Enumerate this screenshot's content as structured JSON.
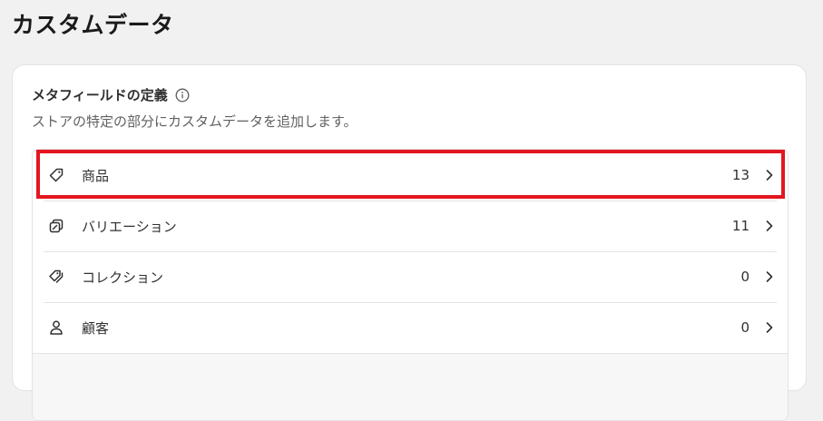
{
  "header": {
    "title": "カスタムデータ"
  },
  "metafields": {
    "title": "メタフィールドの定義",
    "subtitle": "ストアの特定の部分にカスタムデータを追加します。",
    "items": [
      {
        "label": "商品",
        "count": "13",
        "icon": "tag-icon"
      },
      {
        "label": "バリエーション",
        "count": "11",
        "icon": "variant-icon"
      },
      {
        "label": "コレクション",
        "count": "0",
        "icon": "collection-icon"
      },
      {
        "label": "顧客",
        "count": "0",
        "icon": "person-icon"
      }
    ]
  },
  "colors": {
    "highlight": "#e3151f",
    "background": "#f1f1f1",
    "card": "#ffffff",
    "text": "#303030",
    "subtext": "#616161"
  }
}
